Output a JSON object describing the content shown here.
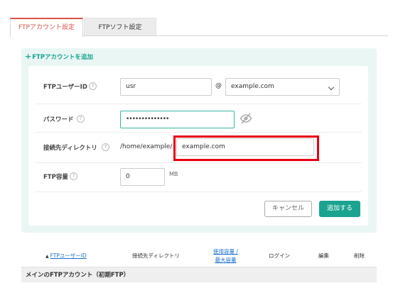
{
  "tabs": [
    {
      "label": "FTPアカウント設定"
    },
    {
      "label": "FTPソフト設定"
    }
  ],
  "add_link": {
    "label": "FTPアカウントを追加"
  },
  "form": {
    "user_id": {
      "label": "FTPユーザーID",
      "value": "usr",
      "at": "@",
      "domain": "example.com"
    },
    "password": {
      "label": "パスワード",
      "value": "••••••••••••••"
    },
    "directory": {
      "label": "接続先ディレクトリ",
      "prefix": "/home/example/",
      "value": "example.com"
    },
    "capacity": {
      "label": "FTP容量",
      "value": "0",
      "unit": "MB"
    },
    "help_glyph": "?"
  },
  "buttons": {
    "cancel": "キャンセル",
    "add": "追加する"
  },
  "table": {
    "headers": {
      "user_id": "FTPユーザーID",
      "directory": "接続先ディレクトリ",
      "usage_line1": "使用容量 /",
      "usage_line2": "最大容量",
      "login": "ログイン",
      "edit": "編集",
      "delete": "削除"
    },
    "group_row": "メインのFTPアカウント（初期FTP）"
  },
  "colors": {
    "accent": "#1aa38f",
    "tab_active": "#d9534f",
    "highlight": "#e60012",
    "link": "#1a6fcf"
  }
}
